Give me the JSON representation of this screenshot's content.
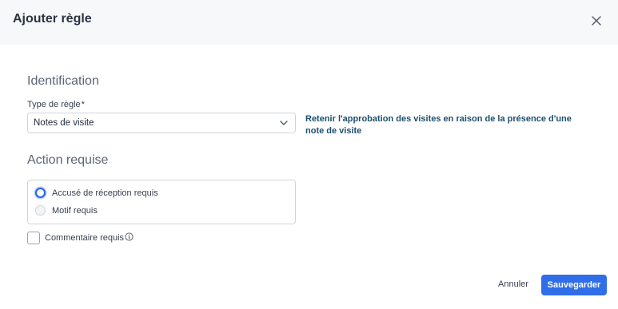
{
  "dialog": {
    "title": "Ajouter règle",
    "close_icon": "close-icon"
  },
  "identification": {
    "section_title": "Identification",
    "rule_type_label": "Type de règle",
    "required_marker": "*",
    "rule_type_value": "Notes de visite",
    "rule_description": "Retenir l'approbation des visites en raison de la présence d'une note de visite"
  },
  "action": {
    "section_title": "Action requise",
    "options": [
      {
        "label": "Accusé de réception requis",
        "selected": true
      },
      {
        "label": "Motif requis",
        "selected": false
      }
    ],
    "comment_label": "Commentaire requis",
    "comment_checked": false,
    "comment_info_icon": "info-icon"
  },
  "footer": {
    "cancel_label": "Annuler",
    "save_label": "Sauvegarder"
  },
  "colors": {
    "primary": "#2f6ee8",
    "description_text": "#1d4f6e",
    "header_bg": "#f7f8f9"
  }
}
